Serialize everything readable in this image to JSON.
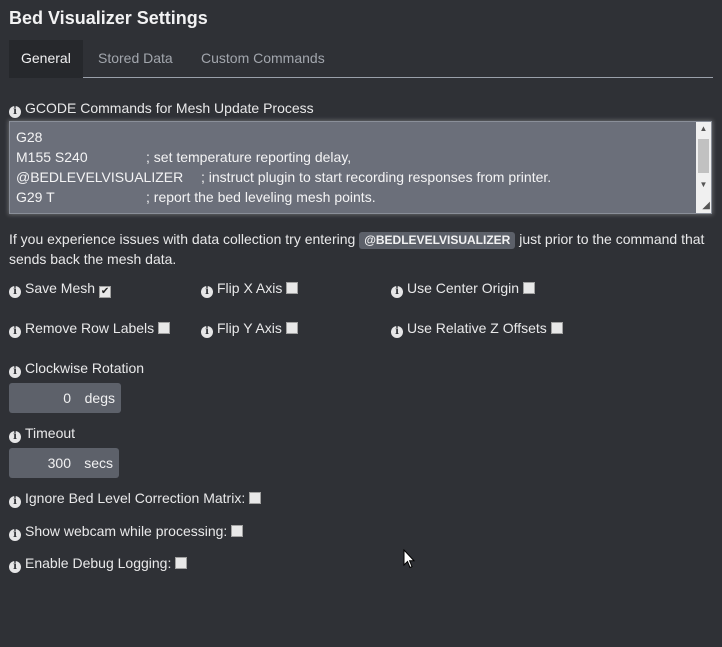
{
  "header": {
    "title": "Bed Visualizer Settings"
  },
  "tabs": [
    {
      "label": "General",
      "active": true
    },
    {
      "label": "Stored Data",
      "active": false
    },
    {
      "label": "Custom Commands",
      "active": false
    }
  ],
  "gcode": {
    "label": "GCODE Commands for Mesh Update Process",
    "lines": [
      {
        "cmd": "G28",
        "comment": ""
      },
      {
        "cmd": "M155 S240",
        "comment": "; set temperature reporting delay,"
      },
      {
        "cmd": "@BEDLEVELVISUALIZER",
        "comment": "; instruct plugin to start recording responses from printer."
      },
      {
        "cmd": "G29 T",
        "comment": "; report the bed leveling mesh points."
      }
    ]
  },
  "help": {
    "before": "If you experience issues with data collection try entering",
    "code": "@BEDLEVELVISUALIZER",
    "after": "just prior to the command that sends back the mesh data."
  },
  "options": {
    "save_mesh": {
      "label": "Save Mesh",
      "checked": true
    },
    "flip_x": {
      "label": "Flip X Axis",
      "checked": false
    },
    "center_origin": {
      "label": "Use Center Origin",
      "checked": false
    },
    "remove_row_labels": {
      "label": "Remove Row Labels",
      "checked": false
    },
    "flip_y": {
      "label": "Flip Y Axis",
      "checked": false
    },
    "relative_z": {
      "label": "Use Relative Z Offsets",
      "checked": false
    }
  },
  "rotation": {
    "label": "Clockwise Rotation",
    "value": "0",
    "unit": "degs"
  },
  "timeout": {
    "label": "Timeout",
    "value": "300",
    "unit": "secs"
  },
  "extra_options": {
    "ignore_matrix": {
      "label": "Ignore Bed Level Correction Matrix:",
      "checked": false
    },
    "show_webcam": {
      "label": "Show webcam while processing:",
      "checked": false
    },
    "debug_logging": {
      "label": "Enable Debug Logging:",
      "checked": false
    }
  },
  "icons": {
    "info": "info-circle-icon",
    "checkmark": "check-icon"
  },
  "colors": {
    "background": "#2f3136",
    "active_tab": "#26282c",
    "textarea": "#6b6f7a",
    "input_group": "#5d616a",
    "badge": "#5c6069"
  }
}
